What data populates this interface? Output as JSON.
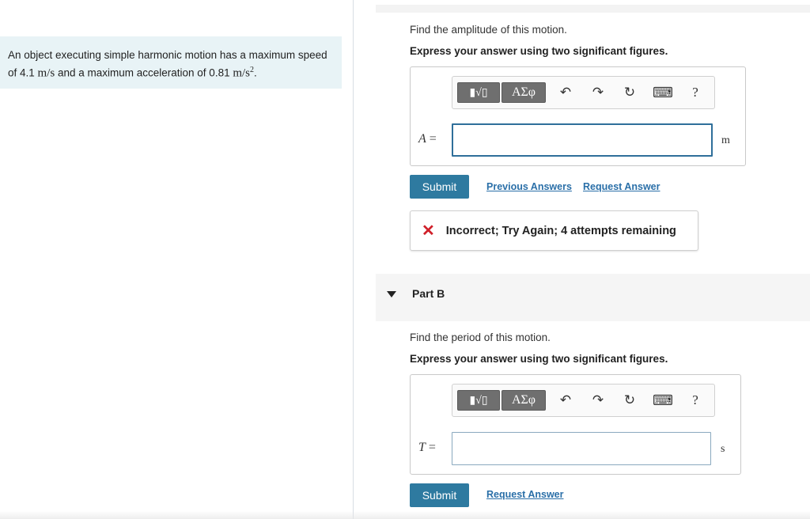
{
  "problem": {
    "text_before": "An object executing simple harmonic motion has a maximum speed of 4.1 ",
    "speed_unit": "m/s",
    "text_middle": " and a maximum acceleration of 0.81 ",
    "accel_unit": "m/s",
    "accel_exp": "2",
    "text_end": "."
  },
  "part_a": {
    "question": "Find the amplitude of this motion.",
    "instruction": "Express your answer using two significant figures.",
    "toolbar": {
      "templates_label": "▮√▯",
      "greek_label": "ΑΣφ",
      "undo": "↶",
      "redo": "↷",
      "reset": "↻",
      "keyboard": "⌨",
      "help": "?"
    },
    "variable": "A",
    "equals": " =",
    "answer_value": "",
    "unit": "m",
    "submit_label": "Submit",
    "prev_answers_label": "Previous Answers",
    "request_answer_label": "Request Answer",
    "feedback_text": "Incorrect; Try Again; 4 attempts remaining",
    "feedback_color": "#d0202a"
  },
  "part_b": {
    "title": "Part B",
    "question": "Find the period of this motion.",
    "instruction": "Express your answer using two significant figures.",
    "variable": "T",
    "equals": " =",
    "answer_value": "",
    "unit": "s",
    "submit_label": "Submit",
    "request_answer_label": "Request Answer"
  }
}
